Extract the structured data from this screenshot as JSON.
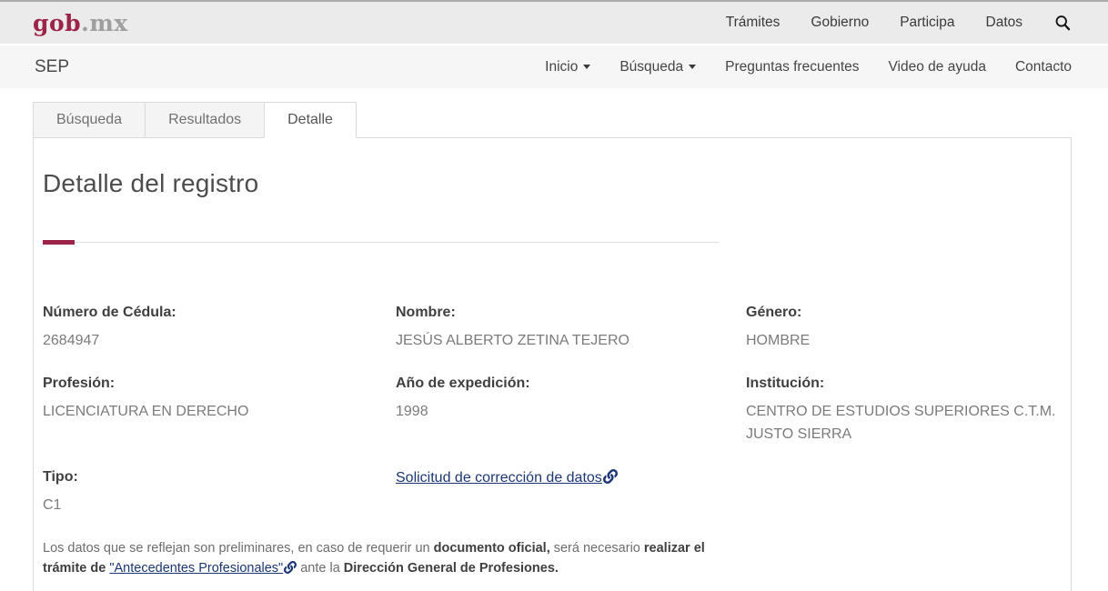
{
  "header": {
    "logo": {
      "gob": "gob",
      "mx": ".mx"
    },
    "nav": [
      "Trámites",
      "Gobierno",
      "Participa",
      "Datos"
    ]
  },
  "subheader": {
    "site": "SEP",
    "nav": [
      "Inicio",
      "Búsqueda",
      "Preguntas frecuentes",
      "Video de ayuda",
      "Contacto"
    ]
  },
  "tabs": [
    {
      "label": "Búsqueda",
      "active": false
    },
    {
      "label": "Resultados",
      "active": false
    },
    {
      "label": "Detalle",
      "active": true
    }
  ],
  "detail": {
    "title": "Detalle del registro",
    "fields": [
      {
        "label": "Número de Cédula:",
        "value": "2684947"
      },
      {
        "label": "Nombre:",
        "value": "JESÚS ALBERTO ZETINA TEJERO"
      },
      {
        "label": "Género:",
        "value": "HOMBRE"
      },
      {
        "label": "Profesión:",
        "value": "LICENCIATURA EN DERECHO"
      },
      {
        "label": "Año de expedición:",
        "value": "1998"
      },
      {
        "label": "Institución:",
        "value": "CENTRO DE ESTUDIOS SUPERIORES C.T.M. JUSTO SIERRA"
      },
      {
        "label": "Tipo:",
        "value": "C1"
      }
    ],
    "correction_link": "Solicitud de corrección de datos",
    "disclaimer": {
      "seg1": "Los datos que se reflejan son preliminares, en caso de requerir un ",
      "seg2_bold": "documento oficial,",
      "seg3": " será necesario ",
      "seg4_bold": "realizar el trámite de ",
      "seg5_link": "\"Antecedentes Profesionales\"",
      "seg6": " ante la ",
      "seg7_bold": "Dirección General de Profesiones."
    }
  },
  "colors": {
    "accent_maroon": "#9d2449",
    "link_navy": "#1c3775",
    "topbar_bg": "#ebebeb",
    "subbar_bg": "#f6f6f6"
  }
}
